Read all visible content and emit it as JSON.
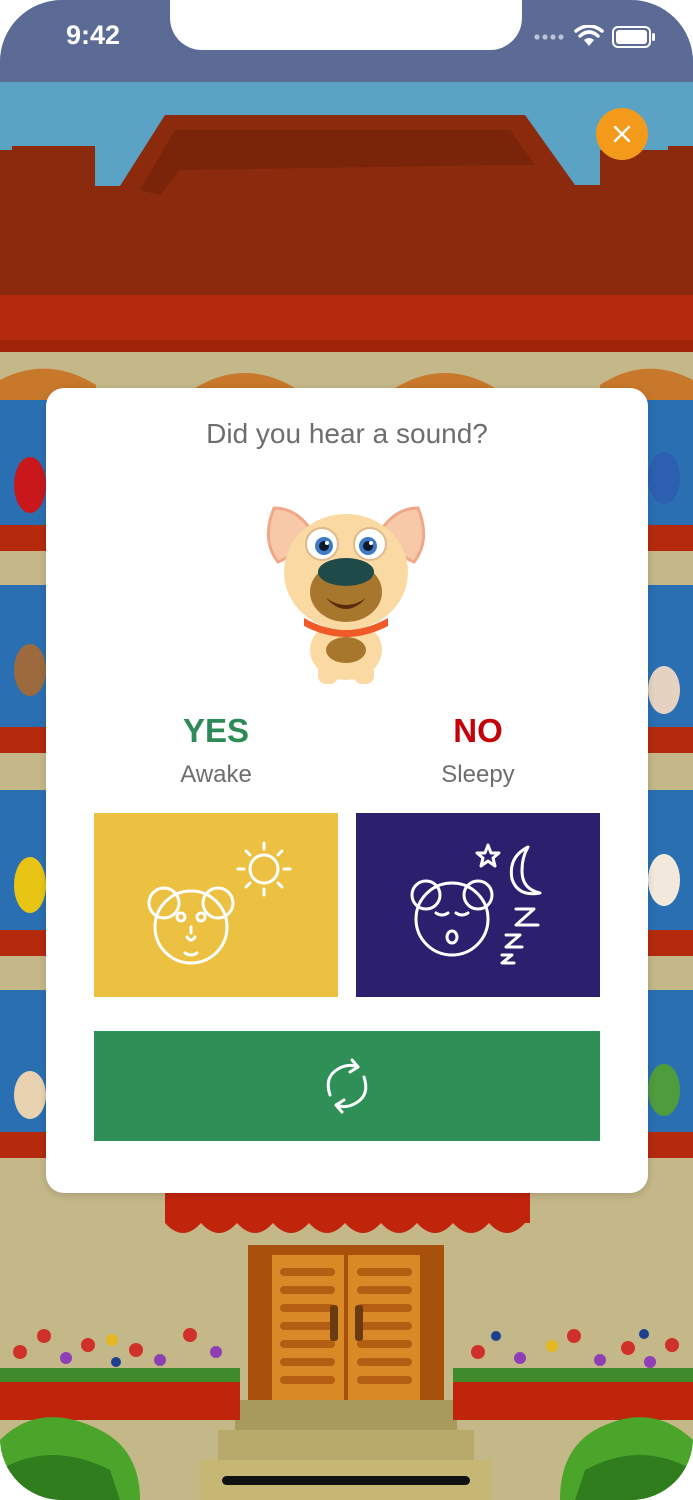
{
  "status_bar": {
    "time": "9:42"
  },
  "dialog": {
    "title": "Did you hear a sound?",
    "yes": {
      "title": "YES",
      "subtitle": "Awake"
    },
    "no": {
      "title": "NO",
      "subtitle": "Sleepy"
    }
  },
  "colors": {
    "sky": "#5aa3c4",
    "roof": "#8b2a0c",
    "wall": "#c4b788",
    "close_button": "#f39a1a",
    "yes_text": "#2e8b57",
    "no_text": "#c4000a",
    "awake_tile": "#ecc040",
    "sleepy_tile": "#2c1f6e",
    "replay_tile": "#2e9057",
    "muted_text": "#6e6e6e"
  },
  "icons": {
    "close": "close-icon",
    "awake": "awake-bear-sun-icon",
    "sleepy": "sleepy-bear-moon-icon",
    "replay": "replay-icon"
  }
}
